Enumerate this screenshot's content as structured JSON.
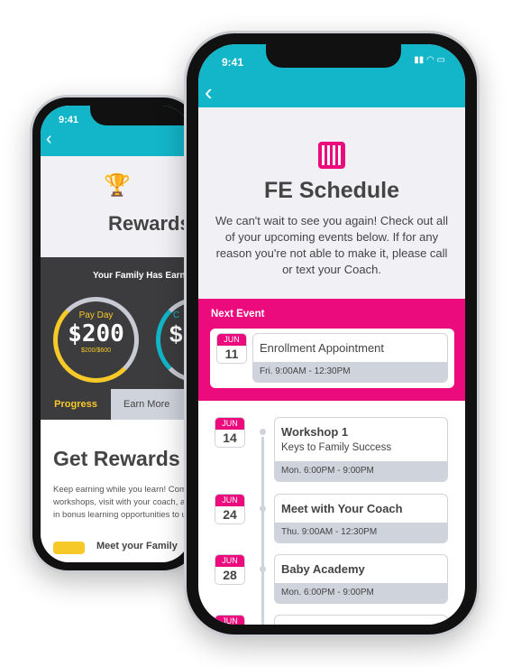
{
  "back_phone": {
    "time": "9:41",
    "title": "Rewards",
    "earned_heading": "Your Family Has Earned",
    "gauge1": {
      "label": "Pay Day",
      "amount": "$200",
      "sub": "$200/$600",
      "progress": 0.33,
      "color": "#f7c928"
    },
    "gauge2": {
      "label": "C",
      "amount": "$",
      "color": "#13b5c9"
    },
    "tabs": [
      "Progress",
      "Earn More"
    ],
    "active_tab": "Progress",
    "heading": "Get Rewards",
    "body": "Keep earning while you learn! Complete workshops, visit with your coach, and participate in bonus learning opportunities to unlock rewards!",
    "next_item": "Meet your Family"
  },
  "front_phone": {
    "time": "9:41",
    "title": "FE Schedule",
    "intro": "We can't wait to see you again! Check out all of your upcoming events below. If for any reason you're not able to make it, please call or text your Coach.",
    "next_event_label": "Next Event",
    "next_event": {
      "month": "JUN",
      "day": "11",
      "title": "Enrollment Appointment",
      "time": "Fri. 9:00AM - 12:30PM"
    },
    "events": [
      {
        "month": "JUN",
        "day": "14",
        "title": "Workshop 1",
        "subtitle": "Keys to Family Success",
        "time": "Mon. 6:00PM - 9:00PM"
      },
      {
        "month": "JUN",
        "day": "24",
        "title": "Meet with Your Coach",
        "time": "Thu. 9:00AM - 12:30PM"
      },
      {
        "month": "JUN",
        "day": "28",
        "title": "Baby Academy",
        "time": "Mon. 6:00PM - 9:00PM"
      },
      {
        "month": "JUN"
      }
    ]
  },
  "colors": {
    "teal": "#13b5c9",
    "pink": "#eb0b7d",
    "gold": "#f7c928"
  }
}
